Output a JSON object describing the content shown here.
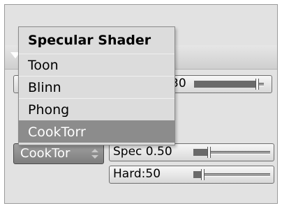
{
  "popup": {
    "title": "Specular Shader",
    "items": [
      {
        "label": "Toon"
      },
      {
        "label": "Blinn"
      },
      {
        "label": "Phong"
      },
      {
        "label": "CookTorr",
        "selected": true
      }
    ]
  },
  "hidden_field": {
    "value_fragment": "30",
    "level": 0.88
  },
  "shader_dropdown": {
    "value": "CookTor"
  },
  "spec_slider": {
    "label": "Spec 0.50",
    "level": 0.25
  },
  "hard_slider": {
    "label": "Hard:50",
    "level": 0.1
  }
}
